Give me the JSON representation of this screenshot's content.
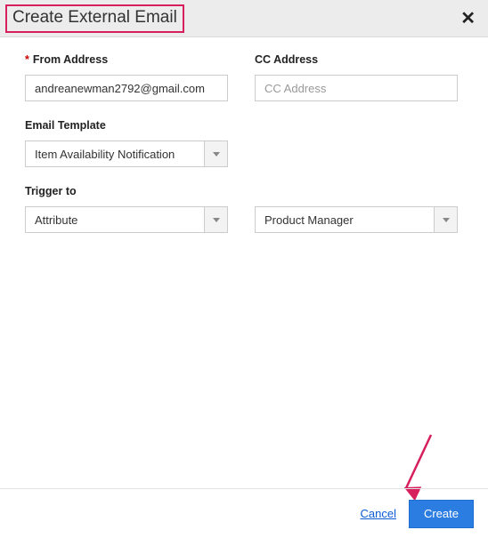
{
  "header": {
    "title": "Create External Email"
  },
  "fields": {
    "from_address": {
      "label": "From Address",
      "value": "andreanewman2792@gmail.com"
    },
    "cc_address": {
      "label": "CC Address",
      "placeholder": "CC Address",
      "value": ""
    },
    "email_template": {
      "label": "Email Template",
      "selected": "Item Availability Notification"
    },
    "trigger_to": {
      "label": "Trigger to",
      "selected": "Attribute",
      "recipient_selected": "Product Manager"
    }
  },
  "footer": {
    "cancel": "Cancel",
    "create": "Create"
  }
}
